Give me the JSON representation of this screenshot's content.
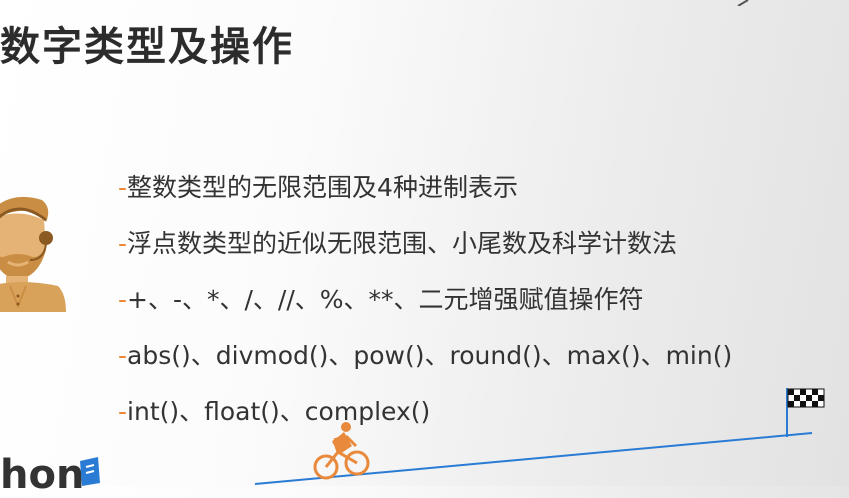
{
  "slide": {
    "title": "数字类型及操作",
    "bullet_marker": "-",
    "bullets": [
      "整数类型的无限范围及4种进制表示",
      "浮点数类型的近似无限范围、小尾数及科学计数法",
      "+、-、*、/、//、%、**、二元增强赋值操作符",
      "abs()、divmod()、pow()、round()、max()、min()",
      "int()、float()、complex()"
    ]
  },
  "branding": {
    "logo_text": "hon"
  },
  "colors": {
    "accent": "#e8893b",
    "text": "#333333",
    "track": "#2a7bd4",
    "avatar": "#d9a25b"
  },
  "icons": {
    "avatar": "person-headset-icon",
    "cyclist": "cyclist-icon",
    "flag": "checkered-flag-icon"
  }
}
